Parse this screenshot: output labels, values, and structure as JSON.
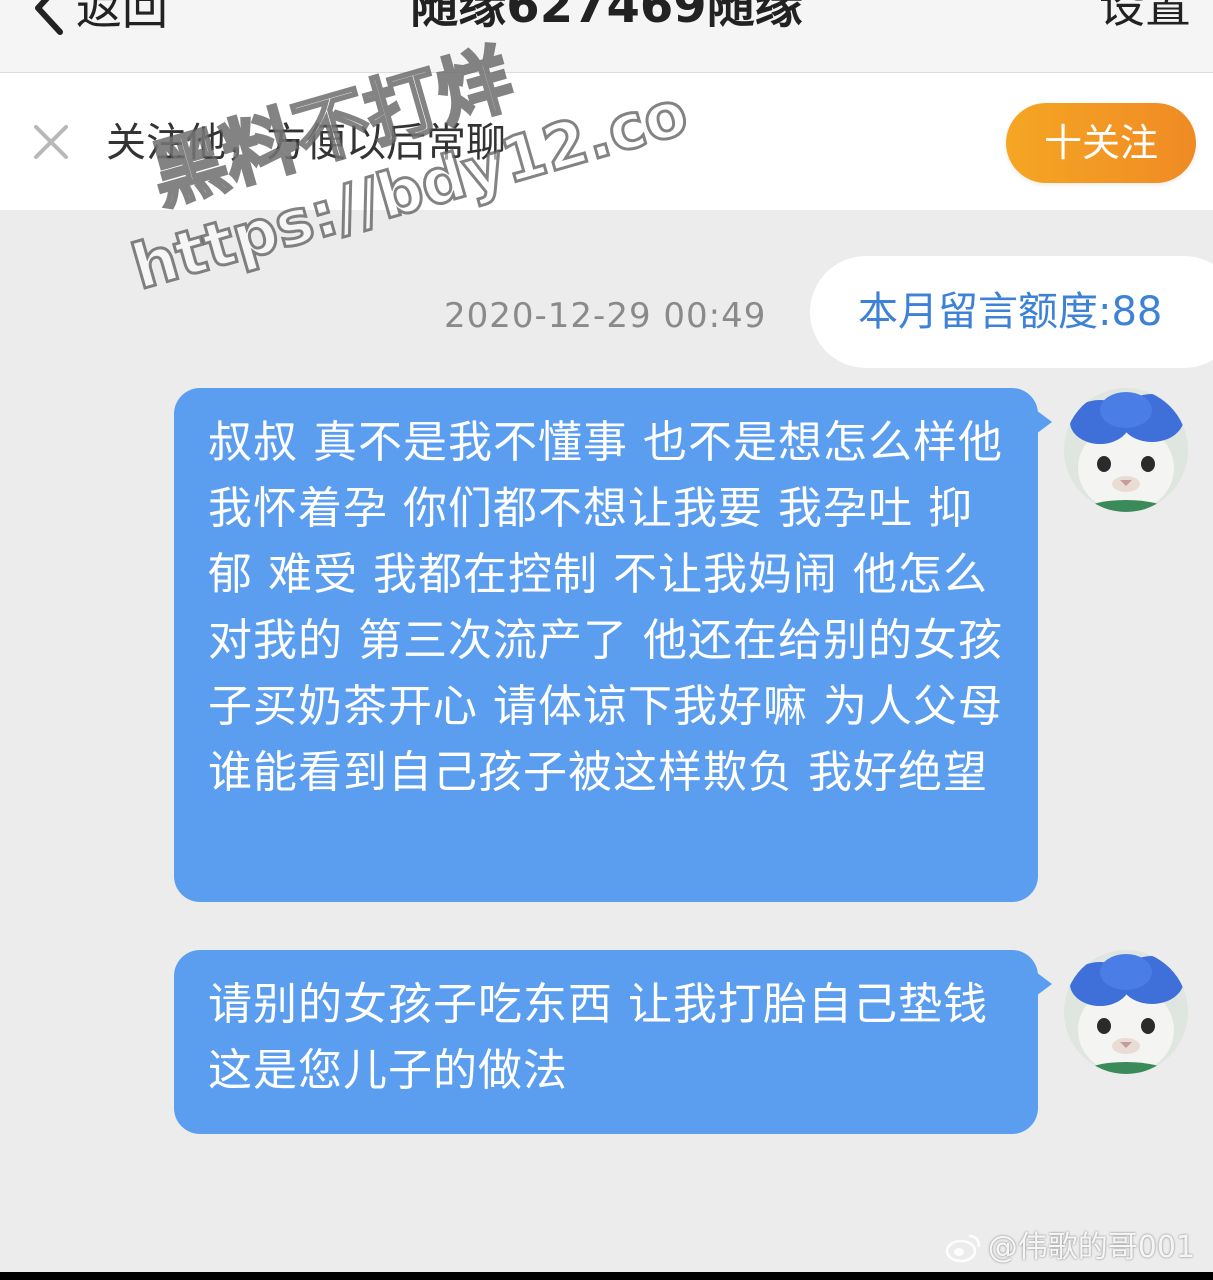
{
  "nav": {
    "back_icon": "chevron-left-icon",
    "back_label": "返回",
    "title": "随缘627469随缘",
    "settings_label": "设置"
  },
  "follow_bar": {
    "close_icon": "close-icon",
    "prompt": "关注他，方便以后常聊",
    "follow_button": "十关注",
    "button_color": "#f5a623"
  },
  "chat": {
    "timestamp": "2020-12-29 00:49",
    "quota": "本月留言额度:88",
    "bubble_color": "#5b9ef0",
    "messages": [
      {
        "text": "叔叔 真不是我不懂事 也不是想怎么样他 我怀着孕 你们都不想让我要 我孕吐 抑郁 难受 我都在控制 不让我妈闹 他怎么对我的 第三次流产了 他还在给别的女孩子买奶茶开心 请体谅下我好嘛 为人父母 谁能看到自己孩子被这样欺负 我好绝望"
      },
      {
        "text": "请别的女孩子吃东西 让我打胎自己垫钱 这是您儿子的做法"
      }
    ]
  },
  "watermark": {
    "line1": "黑料不打烊",
    "line2": "https://bdy12.co"
  },
  "weibo_credit": "@伟歌的哥001"
}
